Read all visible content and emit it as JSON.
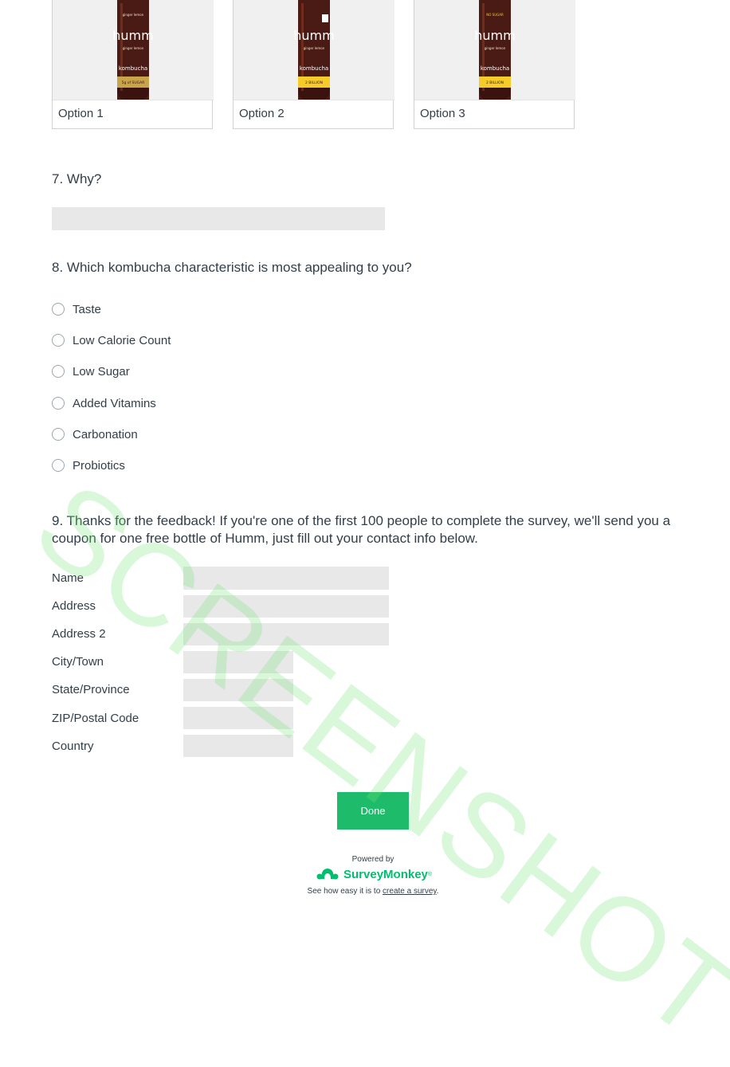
{
  "image_choices": [
    {
      "label": "Option 1",
      "bottle_label_color": "#c9a44a",
      "band_text": "5g of SUGAR"
    },
    {
      "label": "Option 2",
      "bottle_label_color": "#f5cc2a",
      "band_text": "2 BILLION"
    },
    {
      "label": "Option 3",
      "bottle_label_color": "#f5cc2a",
      "band_text": "2 BILLION"
    }
  ],
  "brand": {
    "name": "humm",
    "product": "kombucha",
    "flavor": "ginger lemon"
  },
  "q7": {
    "title": "7. Why?",
    "value": ""
  },
  "q8": {
    "title": "8. Which kombucha characteristic is most appealing to you?",
    "options": [
      "Taste",
      "Low Calorie Count",
      "Low Sugar",
      "Added Vitamins",
      "Carbonation",
      "Probiotics"
    ]
  },
  "q9": {
    "title_line1": "9. Thanks for the feedback! If you're one of the first 100 people to complete the survey, we'll send you a",
    "title_line2": "coupon for one free bottle of Humm, just fill out your contact info below.",
    "fields": [
      {
        "label": "Name",
        "value": ""
      },
      {
        "label": "Address",
        "value": ""
      },
      {
        "label": "Address 2",
        "value": ""
      },
      {
        "label": "City/Town",
        "value": ""
      },
      {
        "label": "State/Province",
        "value": ""
      },
      {
        "label": "ZIP/Postal Code",
        "value": ""
      },
      {
        "label": "Country",
        "value": ""
      }
    ]
  },
  "done_label": "Done",
  "footer": {
    "powered_by": "Powered by",
    "logo_text": "SurveyMonkey",
    "logo_tm": "®",
    "cta_prefix": "See how easy it is to ",
    "cta_link": "create a survey",
    "cta_suffix": "."
  },
  "watermark": "SCREENSHOT",
  "colors": {
    "accent": "#1ebc6a",
    "brand_green": "#00bf6f",
    "text": "#333e48",
    "input_bg": "#e8e8e8"
  }
}
